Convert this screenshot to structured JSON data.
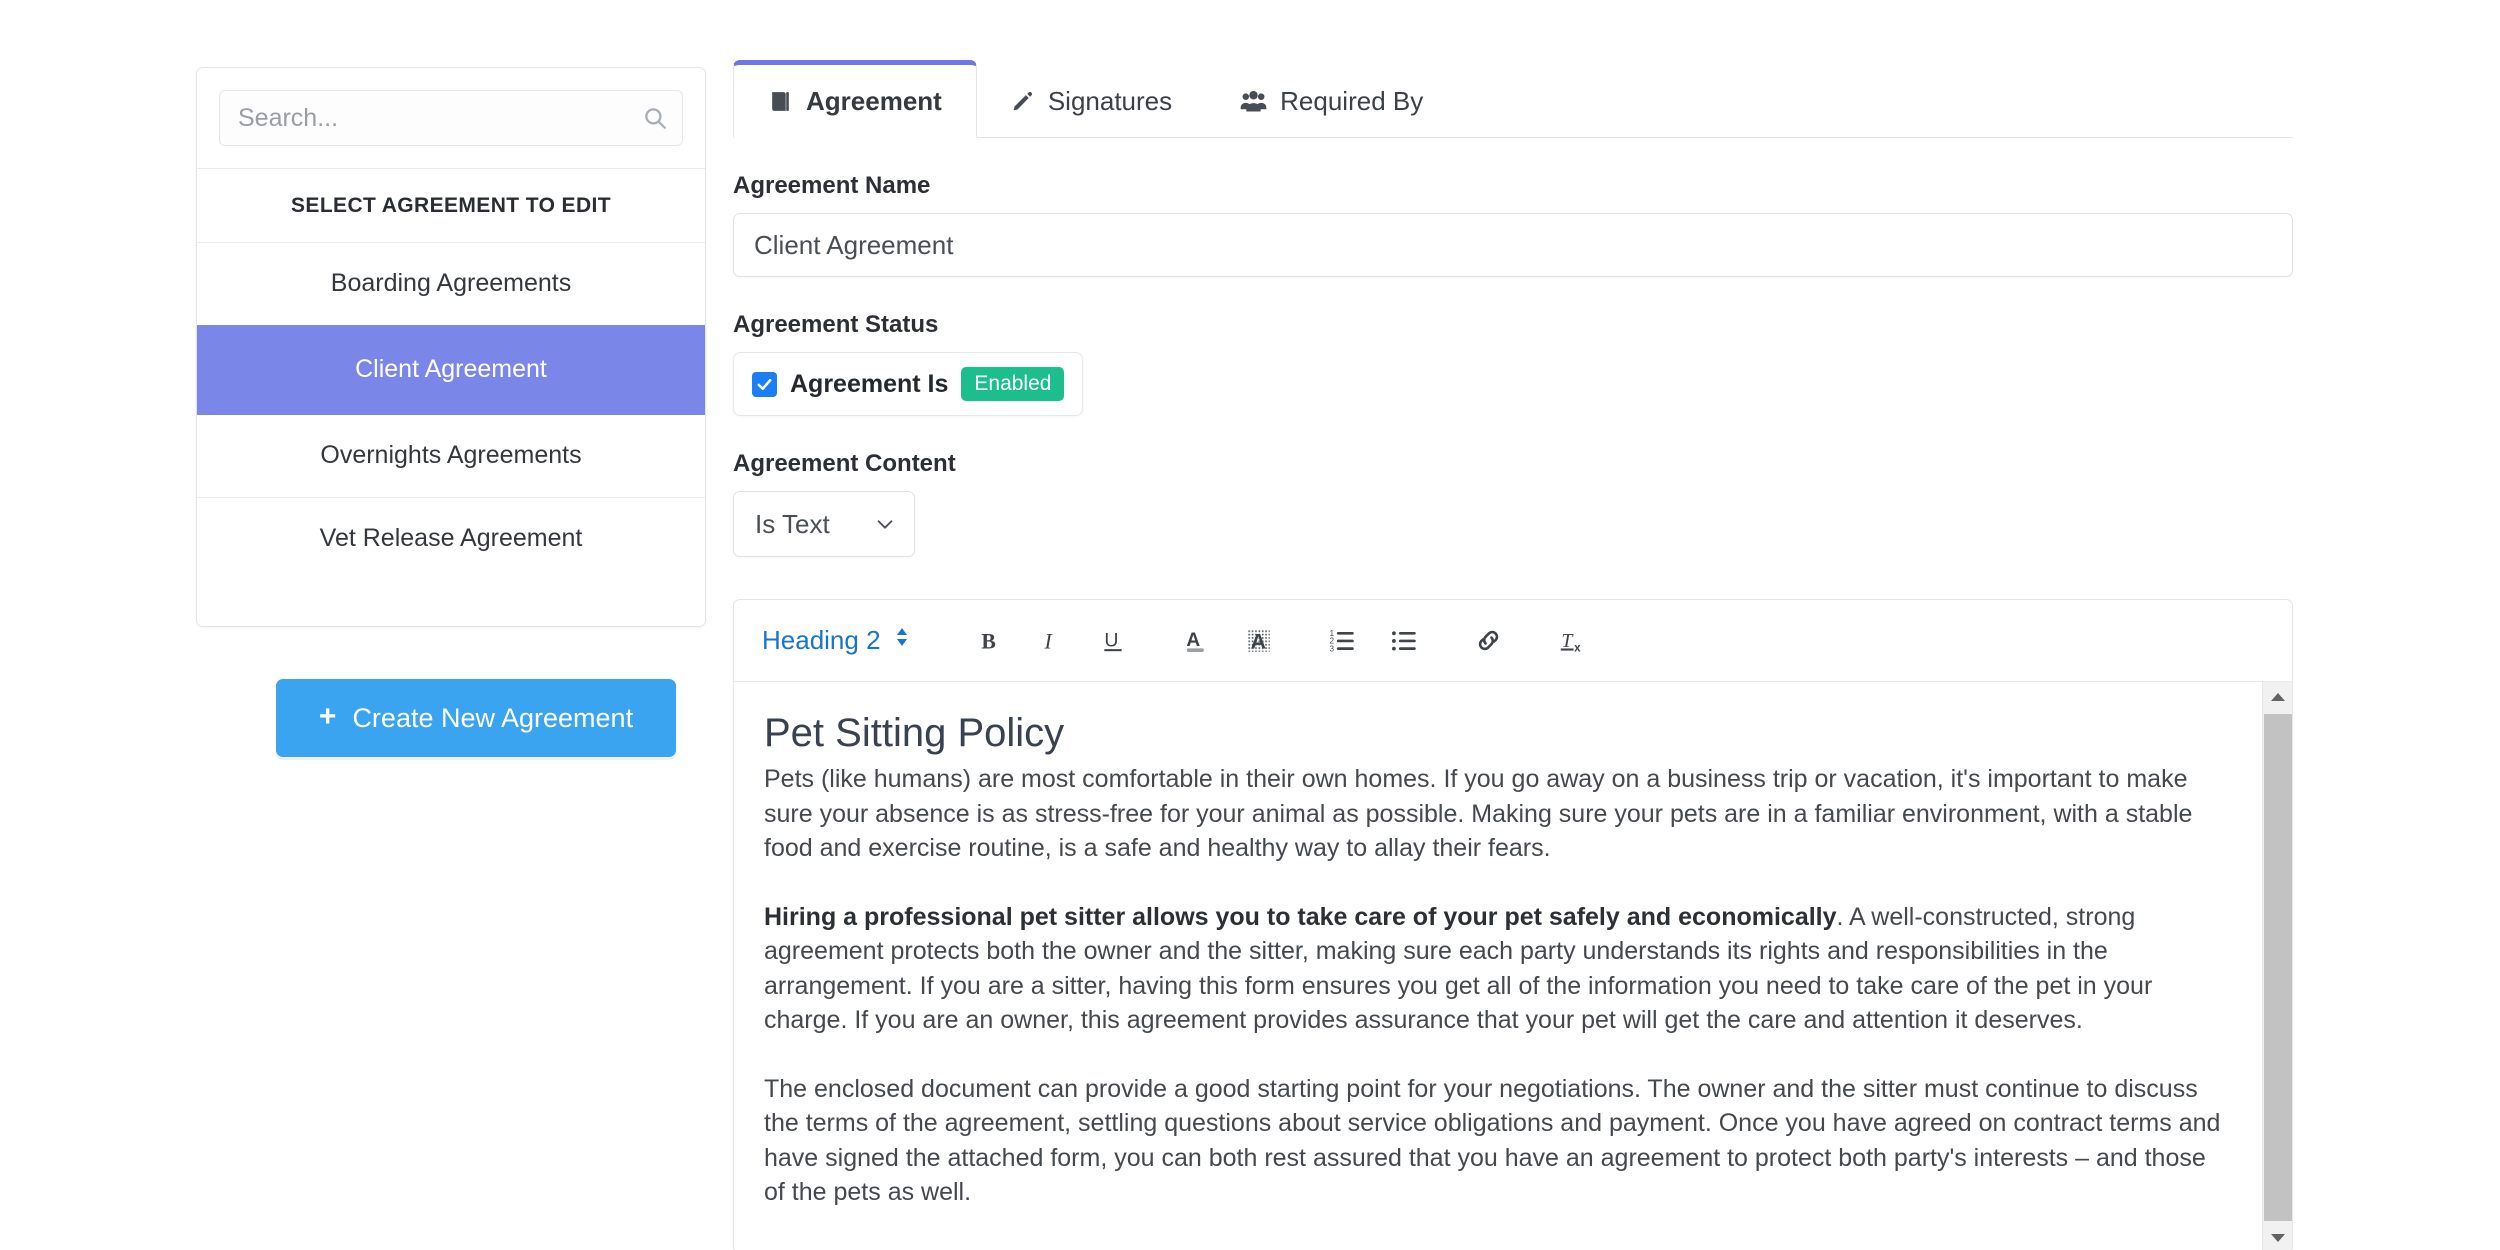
{
  "sidebar": {
    "search": {
      "placeholder": "Search...",
      "value": "",
      "icon": "search-icon"
    },
    "heading": "SELECT AGREEMENT TO EDIT",
    "items": [
      {
        "label": "Boarding Agreements",
        "selected": false
      },
      {
        "label": "Client Agreement",
        "selected": true
      },
      {
        "label": "Overnights Agreements",
        "selected": false
      },
      {
        "label": "Vet Release Agreement",
        "selected": false
      }
    ],
    "create_button": {
      "label": "Create New Agreement",
      "icon": "plus-icon",
      "color": "#3ba4f0"
    }
  },
  "tabs": [
    {
      "label": "Agreement",
      "icon": "book-icon",
      "active": true
    },
    {
      "label": "Signatures",
      "icon": "pencil-icon",
      "active": false
    },
    {
      "label": "Required By",
      "icon": "users-icon",
      "active": false
    }
  ],
  "form": {
    "name_label": "Agreement Name",
    "name_value": "Client Agreement",
    "status_label": "Agreement Status",
    "status_checkbox_label": "Agreement Is",
    "status_badge": "Enabled",
    "status_checked": true,
    "content_label": "Agreement Content",
    "content_select_value": "Is Text",
    "content_select_options": [
      "Is Text"
    ]
  },
  "editor": {
    "toolbar": {
      "style_label": "Heading 2",
      "buttons": [
        {
          "name": "bold-icon",
          "title": "Bold"
        },
        {
          "name": "italic-icon",
          "title": "Italic"
        },
        {
          "name": "underline-icon",
          "title": "Underline"
        },
        {
          "name": "text-color-icon",
          "title": "Text Color"
        },
        {
          "name": "highlight-icon",
          "title": "Highlight"
        },
        {
          "name": "ordered-list-icon",
          "title": "Numbered List"
        },
        {
          "name": "unordered-list-icon",
          "title": "Bulleted List"
        },
        {
          "name": "link-icon",
          "title": "Insert Link"
        },
        {
          "name": "remove-format-icon",
          "title": "Remove Formatting"
        }
      ]
    },
    "document": {
      "heading": "Pet Sitting Policy",
      "paragraph_1": "Pets (like humans) are most comfortable in their own homes. If you go away on a business trip or vacation, it's important to make sure your absence is as stress-free for your animal as possible. Making sure your pets are in a familiar environment, with a stable food and exercise routine, is a safe and healthy way to allay their fears.",
      "paragraph_2_bold": "Hiring a professional pet sitter allows you to take care of your pet safely and economically",
      "paragraph_2_rest": ". A well-constructed, strong agreement protects both the owner and the sitter, making sure each party understands its rights and responsibilities in the arrangement. If you are a sitter, having this form ensures you get all of the information you need to take care of the pet in your charge. If you are an owner, this agreement provides assurance that your pet will get the care and attention it deserves.",
      "paragraph_3": "The enclosed document can provide a good starting point for your negotiations. The owner and the sitter must continue to discuss the terms of the agreement, settling questions about service obligations and payment. Once you have agreed on contract terms and have signed the attached form, you can both rest assured that you have an agreement to protect both party's interests – and those of the pets as well."
    }
  },
  "colors": {
    "selected_item": "#7b87e8",
    "active_tab_border": "#6c76e8",
    "primary_button": "#3ba4f0",
    "badge_enabled": "#1cbf8c",
    "checkbox": "#1a7ef5",
    "toolbar_link": "#1675d1"
  }
}
